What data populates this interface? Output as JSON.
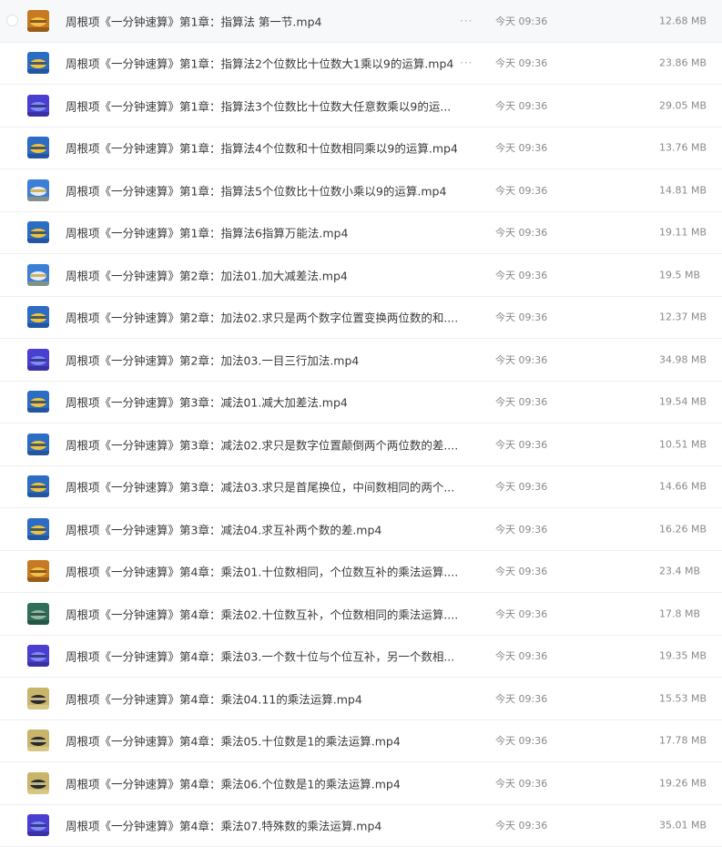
{
  "files": [
    {
      "name": "周根项《一分钟速算》第1章：指算法 第一节.mp4",
      "time": "今天 09:36",
      "size": "12.68 MB",
      "more": "···",
      "thumb": "orange",
      "hover": true
    },
    {
      "name": "周根项《一分钟速算》第1章：指算法2个位数比十位数大1乘以9的运算.mp4",
      "time": "今天 09:36",
      "size": "23.86 MB",
      "more": "···",
      "thumb": "blue-yellow"
    },
    {
      "name": "周根项《一分钟速算》第1章：指算法3个位数比十位数大任意数乘以9的运...",
      "time": "今天 09:36",
      "size": "29.05 MB",
      "thumb": "purple"
    },
    {
      "name": "周根项《一分钟速算》第1章：指算法4个位数和十位数相同乘以9的运算.mp4",
      "time": "今天 09:36",
      "size": "13.76 MB",
      "thumb": "blue-yellow"
    },
    {
      "name": "周根项《一分钟速算》第1章：指算法5个位数比十位数小乘以9的运算.mp4",
      "time": "今天 09:36",
      "size": "14.81 MB",
      "thumb": "blue-white"
    },
    {
      "name": "周根项《一分钟速算》第1章：指算法6指算万能法.mp4",
      "time": "今天 09:36",
      "size": "19.11 MB",
      "thumb": "blue-yellow"
    },
    {
      "name": "周根项《一分钟速算》第2章：加法01.加大减差法.mp4",
      "time": "今天 09:36",
      "size": "19.5 MB",
      "thumb": "blue-white"
    },
    {
      "name": "周根项《一分钟速算》第2章：加法02.求只是两个数字位置变换两位数的和....",
      "time": "今天 09:36",
      "size": "12.37 MB",
      "thumb": "blue-yellow"
    },
    {
      "name": "周根项《一分钟速算》第2章：加法03.一目三行加法.mp4",
      "time": "今天 09:36",
      "size": "34.98 MB",
      "thumb": "purple"
    },
    {
      "name": "周根项《一分钟速算》第3章：减法01.减大加差法.mp4",
      "time": "今天 09:36",
      "size": "19.54 MB",
      "thumb": "blue-yellow"
    },
    {
      "name": "周根项《一分钟速算》第3章：减法02.求只是数字位置颠倒两个两位数的差....",
      "time": "今天 09:36",
      "size": "10.51 MB",
      "thumb": "blue-yellow"
    },
    {
      "name": "周根项《一分钟速算》第3章：减法03.求只是首尾换位，中间数相同的两个...",
      "time": "今天 09:36",
      "size": "14.66 MB",
      "thumb": "blue-yellow"
    },
    {
      "name": "周根项《一分钟速算》第3章：减法04.求互补两个数的差.mp4",
      "time": "今天 09:36",
      "size": "16.26 MB",
      "thumb": "blue-yellow"
    },
    {
      "name": "周根项《一分钟速算》第4章：乘法01.十位数相同，个位数互补的乘法运算....",
      "time": "今天 09:36",
      "size": "23.4 MB",
      "thumb": "orange"
    },
    {
      "name": "周根项《一分钟速算》第4章：乘法02.十位数互补，个位数相同的乘法运算....",
      "time": "今天 09:36",
      "size": "17.8 MB",
      "thumb": "green"
    },
    {
      "name": "周根项《一分钟速算》第4章：乘法03.一个数十位与个位互补，另一个数相...",
      "time": "今天 09:36",
      "size": "19.35 MB",
      "thumb": "purple"
    },
    {
      "name": "周根项《一分钟速算》第4章：乘法04.11的乘法运算.mp4",
      "time": "今天 09:36",
      "size": "15.53 MB",
      "thumb": "person"
    },
    {
      "name": "周根项《一分钟速算》第4章：乘法05.十位数是1的乘法运算.mp4",
      "time": "今天 09:36",
      "size": "17.78 MB",
      "thumb": "person"
    },
    {
      "name": "周根项《一分钟速算》第4章：乘法06.个位数是1的乘法运算.mp4",
      "time": "今天 09:36",
      "size": "19.26 MB",
      "thumb": "person"
    },
    {
      "name": "周根项《一分钟速算》第4章：乘法07.特殊数的乘法运算.mp4",
      "time": "今天 09:36",
      "size": "35.01 MB",
      "thumb": "purple"
    }
  ],
  "thumb_colors": {
    "orange": [
      "#c77a22",
      "#f4c04a",
      "#6b3f12"
    ],
    "blue-yellow": [
      "#2b6cc4",
      "#f0c23a",
      "#1a3f7a"
    ],
    "blue-white": [
      "#3b7fd6",
      "#e8edf5",
      "#c9a23a"
    ],
    "purple": [
      "#4a3fd0",
      "#7d8cf0",
      "#2a237a"
    ],
    "green": [
      "#2f6e5a",
      "#8fb9a0",
      "#1d3e35"
    ],
    "person": [
      "#c9b56a",
      "#2a2a2a",
      "#e6d9a0"
    ]
  }
}
